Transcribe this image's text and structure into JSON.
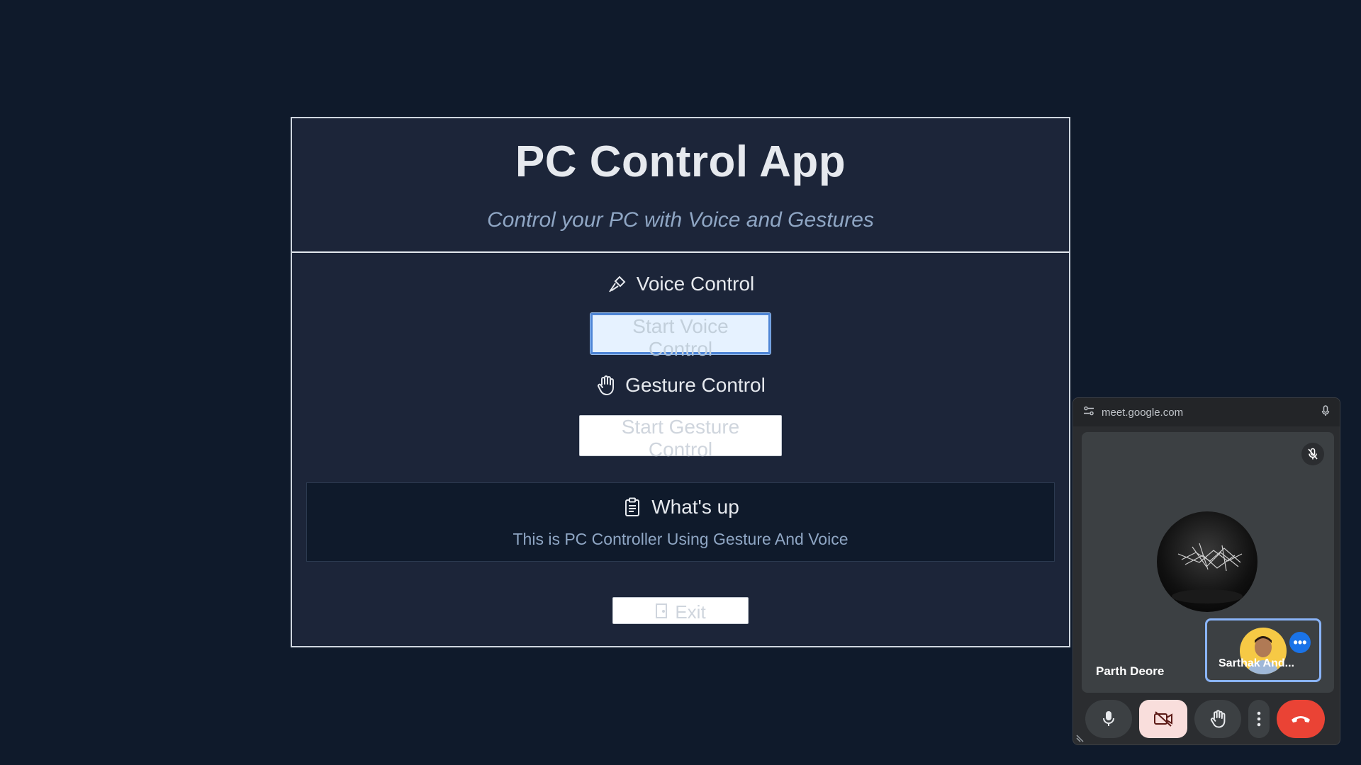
{
  "app": {
    "title": "PC Control App",
    "subtitle": "Control your PC with Voice and Gestures",
    "voice": {
      "heading": "Voice Control",
      "icon": "microphone-icon",
      "button_label": "Start Voice Control"
    },
    "gesture": {
      "heading": "Gesture Control",
      "icon": "hand-icon",
      "button_label": "Start Gesture Control"
    },
    "status": {
      "heading": "What's up",
      "icon": "clipboard-icon",
      "text": "This is PC Controller Using Gesture And Voice"
    },
    "exit": {
      "label": "Exit",
      "icon": "door-icon"
    }
  },
  "meet": {
    "url": "meet.google.com",
    "main_participant": "Parth Deore",
    "self_participant": "Sarthak And...",
    "more_label": "•••",
    "controls": [
      "microphone",
      "camera-off",
      "raise-hand",
      "more-options",
      "end-call"
    ]
  },
  "colors": {
    "background": "#0f1a2b",
    "panel": "#1c2539",
    "accent_blue": "#4f86d6",
    "end_call": "#ea4335"
  }
}
